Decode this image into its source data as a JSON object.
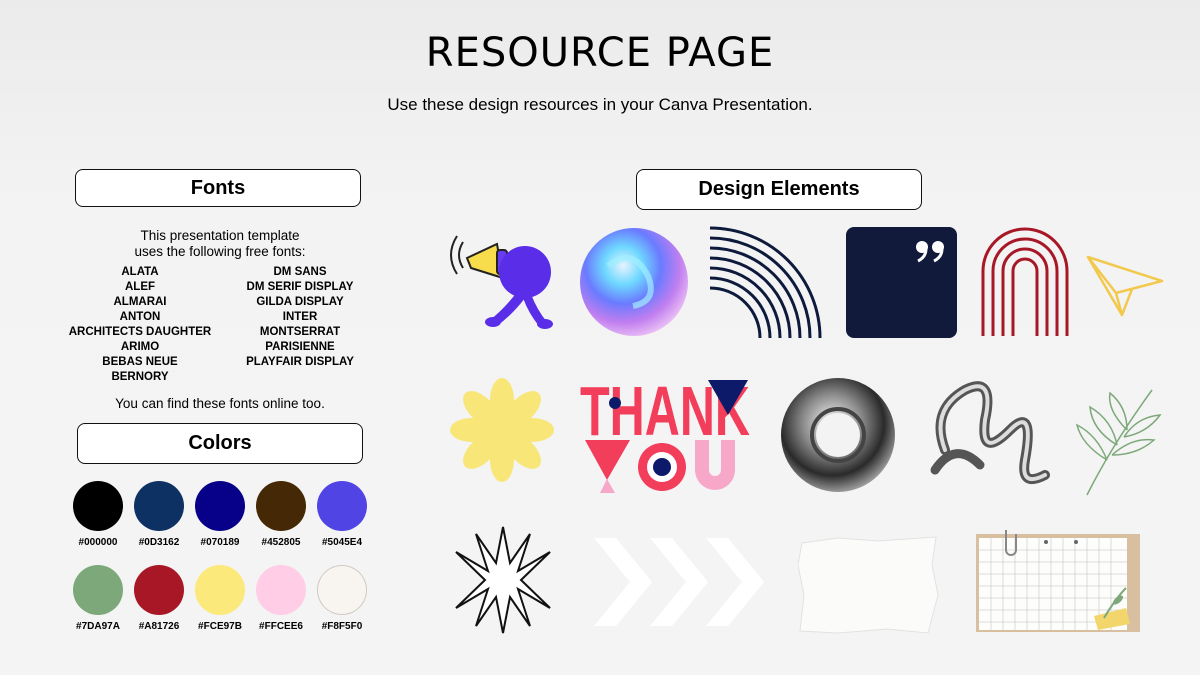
{
  "page": {
    "title": "RESOURCE PAGE",
    "subtitle": "Use these design resources in your Canva Presentation."
  },
  "fonts": {
    "heading": "Fonts",
    "intro_line1": "This presentation template",
    "intro_line2": "uses the following free fonts:",
    "left_column": [
      "ALATA",
      "ALEF",
      "ALMARAI",
      "ANTON",
      "ARCHITECTS DAUGHTER",
      "ARIMO",
      "BEBAS NEUE",
      "BERNORY"
    ],
    "right_column": [
      "DM SANS",
      "DM SERIF DISPLAY",
      "GILDA DISPLAY",
      "INTER",
      "MONTSERRAT",
      "PARISIENNE",
      "PLAYFAIR DISPLAY"
    ],
    "footer": "You can find these fonts online too."
  },
  "colors": {
    "heading": "Colors",
    "swatches": [
      {
        "hex": "#000000",
        "color": "#000000"
      },
      {
        "hex": "#0D3162",
        "color": "#0D3162"
      },
      {
        "hex": "#070189",
        "color": "#070189"
      },
      {
        "hex": "#452805",
        "color": "#452805"
      },
      {
        "hex": "#5045E4",
        "color": "#5045E4"
      },
      {
        "hex": "#7DA97A",
        "color": "#7DA97A"
      },
      {
        "hex": "#A81726",
        "color": "#A81726"
      },
      {
        "hex": "#FCE97B",
        "color": "#FCE97B"
      },
      {
        "hex": "#FFCEE6",
        "color": "#FFCEE6"
      },
      {
        "hex": "#F8F5F0",
        "color": "#F8F5F0"
      }
    ]
  },
  "design_elements": {
    "heading": "Design Elements",
    "thank_you": {
      "line1": "THANK",
      "line2": "YOU"
    }
  }
}
